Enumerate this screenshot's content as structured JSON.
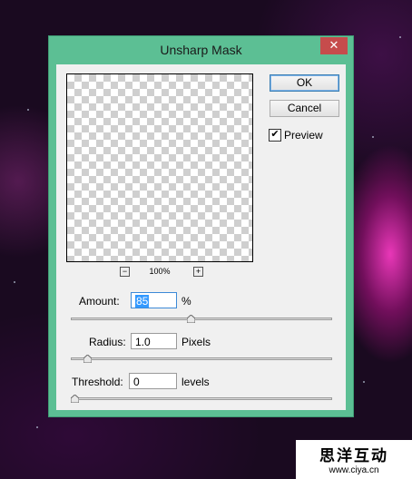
{
  "dialog": {
    "title": "Unsharp Mask",
    "close_glyph": "✕",
    "ok_label": "OK",
    "cancel_label": "Cancel",
    "preview_label": "Preview",
    "preview_checked": true,
    "zoom_level": "100%",
    "zoom_out_glyph": "−",
    "zoom_in_glyph": "+"
  },
  "params": {
    "amount": {
      "label": "Amount:",
      "value": "85",
      "unit": "%",
      "slider_fraction": 0.46
    },
    "radius": {
      "label": "Radius:",
      "value": "1.0",
      "unit": "Pixels",
      "slider_fraction": 0.05
    },
    "threshold": {
      "label": "Threshold:",
      "value": "0",
      "unit": "levels",
      "slider_fraction": 0.0
    }
  },
  "watermark": {
    "chinese": "思洋互动",
    "url": "www.ciya.cn"
  },
  "colors": {
    "window_frame": "#5cbf94",
    "close_button": "#c64c4c",
    "selection": "#3399ff"
  }
}
